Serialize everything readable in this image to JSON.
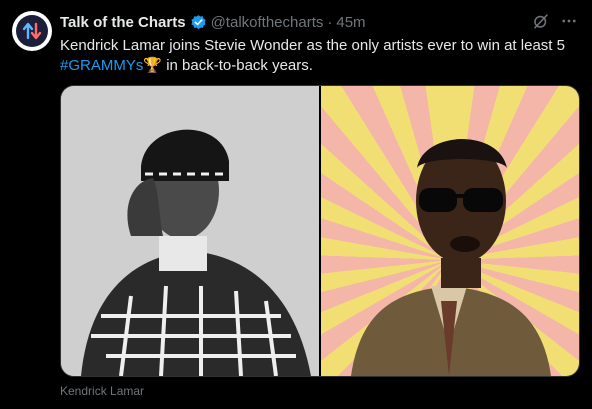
{
  "tweet": {
    "author_name": "Talk of the Charts",
    "handle": "@talkofthecharts",
    "separator": "·",
    "time": "45m",
    "text_before": "Kendrick Lamar joins Stevie Wonder as the only artists ever to win at least 5",
    "hashtag": "#GRAMMYs",
    "emoji": "🏆",
    "text_after": "in back-to-back years."
  },
  "media": {
    "caption": "Kendrick Lamar"
  },
  "icons": {
    "avatar": "up-down-arrows-logo",
    "verified": "verified-badge-icon",
    "grok": "grok-icon",
    "more": "more-icon"
  },
  "colors": {
    "background": "#000000",
    "text": "#e7e9ea",
    "muted": "#71767b",
    "accent": "#1d9bf0"
  }
}
